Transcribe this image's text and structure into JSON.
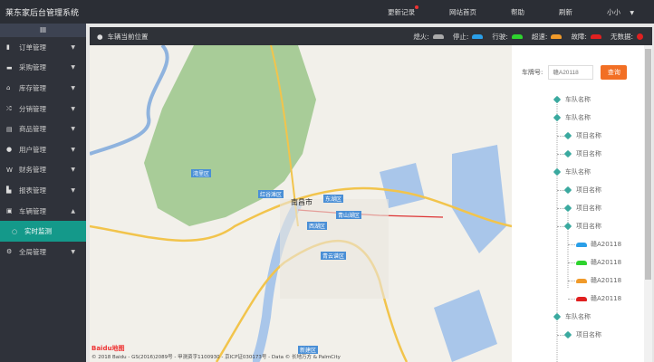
{
  "app": {
    "title": "莱东家后台管理系统"
  },
  "topnav": {
    "items": [
      "更新记录",
      "网站首页",
      "帮助",
      "刷新"
    ],
    "user": "小小"
  },
  "sidebar": {
    "toggle": "III",
    "items": [
      {
        "label": "订单管理",
        "icon": "file-icon"
      },
      {
        "label": "采购管理",
        "icon": "briefcase-icon"
      },
      {
        "label": "库存管理",
        "icon": "bank-icon"
      },
      {
        "label": "分销管理",
        "icon": "shuffle-icon"
      },
      {
        "label": "商品管理",
        "icon": "print-icon"
      },
      {
        "label": "用户管理",
        "icon": "user-icon"
      },
      {
        "label": "财务管理",
        "icon": "won-icon"
      },
      {
        "label": "报表管理",
        "icon": "chart-icon"
      },
      {
        "label": "车辆管理",
        "icon": "car-icon"
      }
    ],
    "active_sub": "实时监测",
    "last": "全局管理"
  },
  "panel": {
    "title": "车辆当前位置",
    "legend": [
      {
        "label": "熄火:",
        "color": "#aaaaaa"
      },
      {
        "label": "停止:",
        "color": "#2a9fe8"
      },
      {
        "label": "行驶:",
        "color": "#2ed32e"
      },
      {
        "label": "超速:",
        "color": "#f09a2a"
      },
      {
        "label": "故障:",
        "color": "#e02020"
      }
    ],
    "nodata": "无数据:",
    "nodata_color": "#e02020"
  },
  "map": {
    "labels": [
      "南昌市",
      "红谷滩区",
      "东湖区",
      "青山湖区",
      "西湖区",
      "青云谱区",
      "新建区",
      "湾里区"
    ],
    "attribution": "© 2018 Baidu - GS(2016)2089号 - 甲测资字1100930 - 京ICP证030173号 - Data © 长地万方 & PalmCity",
    "logo": "Baidu地图"
  },
  "search": {
    "label": "车牌号:",
    "placeholder": "赣A20118",
    "button": "查询"
  },
  "tree": [
    {
      "level": 0,
      "label": "车队名称"
    },
    {
      "level": 0,
      "label": "车队名称"
    },
    {
      "level": 1,
      "label": "项目名称"
    },
    {
      "level": 1,
      "label": "项目名称"
    },
    {
      "level": 0,
      "label": "车队名称"
    },
    {
      "level": 1,
      "label": "项目名称"
    },
    {
      "level": 1,
      "label": "项目名称"
    },
    {
      "level": 1,
      "label": "项目名称"
    },
    {
      "level": 2,
      "label": "赣A20118",
      "color": "#2a9fe8"
    },
    {
      "level": 2,
      "label": "赣A20118",
      "color": "#2ed32e"
    },
    {
      "level": 2,
      "label": "赣A20118",
      "color": "#f09a2a"
    },
    {
      "level": 2,
      "label": "赣A20118",
      "color": "#e02020"
    },
    {
      "level": 0,
      "label": "车队名称"
    },
    {
      "level": 1,
      "label": "项目名称"
    }
  ]
}
